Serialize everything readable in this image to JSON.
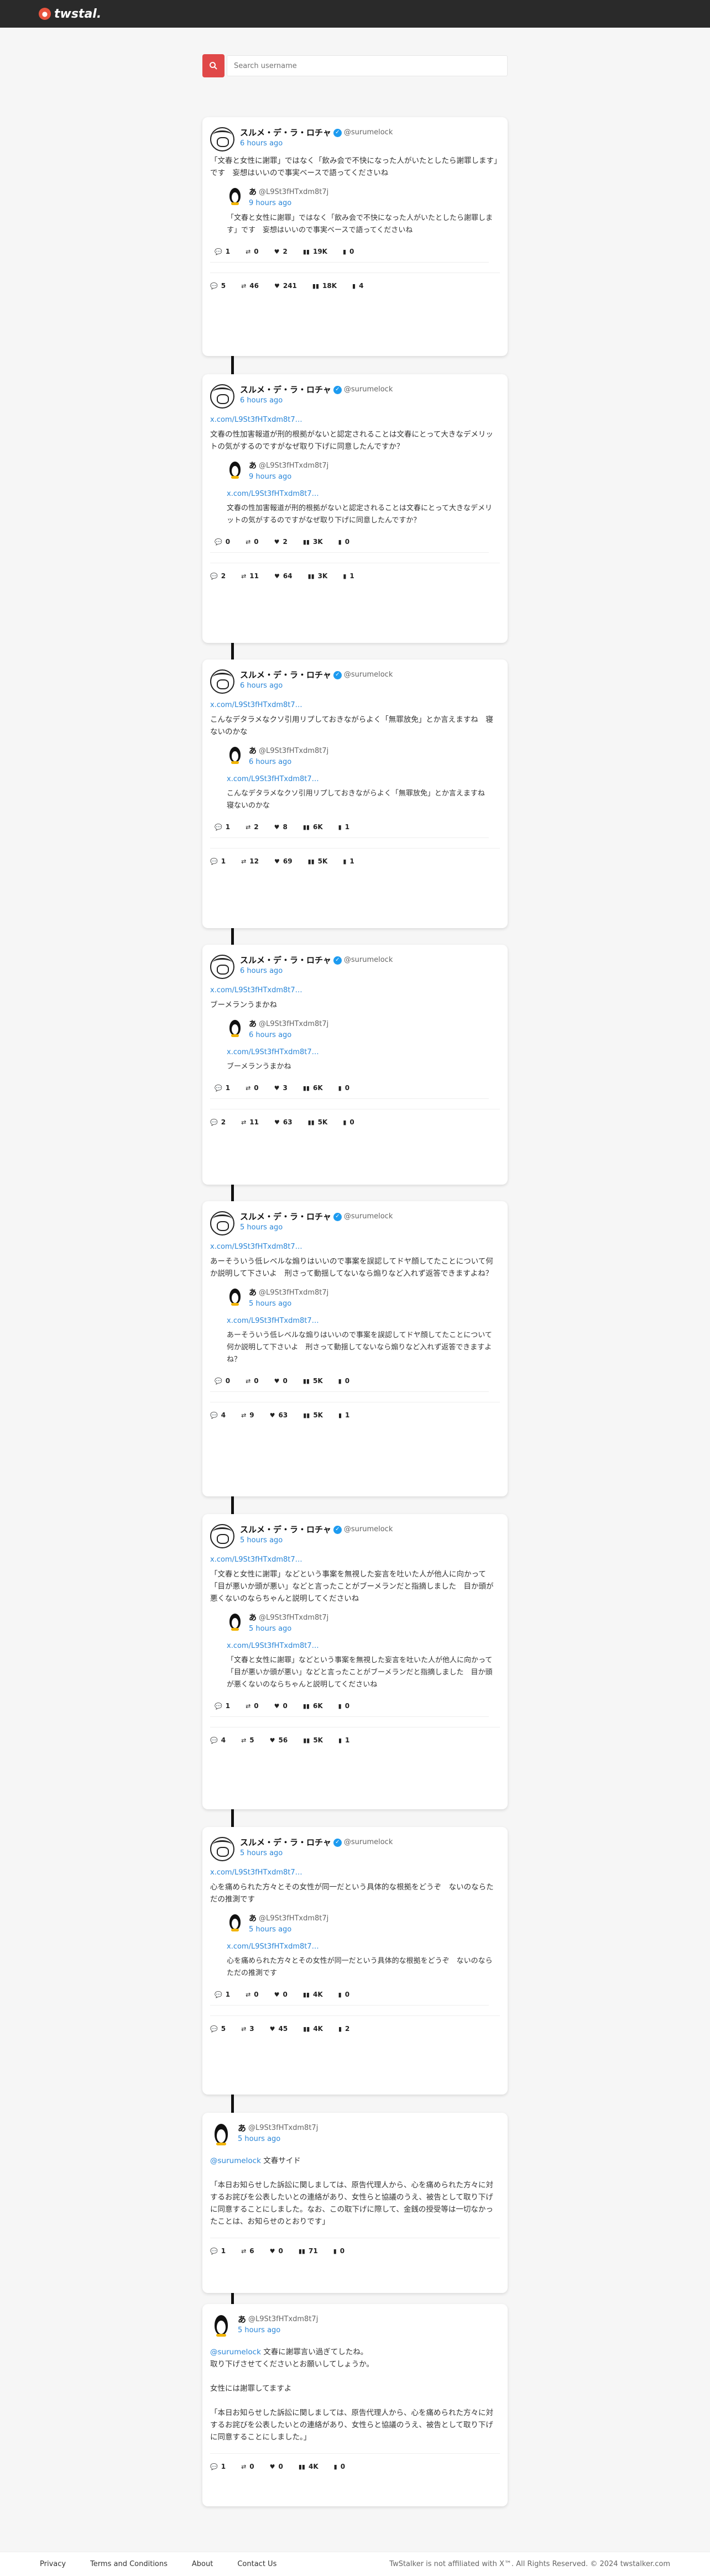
{
  "brand": {
    "name": "twstal."
  },
  "search": {
    "placeholder": "Search username"
  },
  "tweets": [
    {
      "name": "スルメ・デ・ラ・ロチャ",
      "handle": "@surumelock",
      "time": "6 hours ago",
      "link": "",
      "text": "「文春と女性に謝罪」ではなく「飲み会で不快になった人がいたとしたら謝罪します」です　妄想はいいので事実ベースで語ってくださいね",
      "quote": {
        "name": "あ",
        "handle": "@L9St3fHTxdm8t7j",
        "time": "9 hours ago",
        "link": "",
        "text": "「文春と女性に謝罪」ではなく「飲み会で不快になった人がいたとしたら謝罪します」です　妄想はいいので事実ベースで語ってくださいね",
        "stats": {
          "replies": "1",
          "retweets": "0",
          "likes": "2",
          "views": "19K",
          "bookmarks": "0"
        }
      },
      "stats": {
        "replies": "5",
        "retweets": "46",
        "likes": "241",
        "views": "18K",
        "bookmarks": "4"
      }
    },
    {
      "name": "スルメ・デ・ラ・ロチャ",
      "handle": "@surumelock",
      "time": "6 hours ago",
      "link": "x.com/L9St3fHTxdm8t7…",
      "text": "文春の性加害報道が刑的根拠がないと認定されることは文春にとって大きなデメリットの気がするのですがなぜ取り下げに同意したんですか？",
      "quote": {
        "name": "あ",
        "handle": "@L9St3fHTxdm8t7j",
        "time": "9 hours ago",
        "link": "x.com/L9St3fHTxdm8t7…",
        "text": "文春の性加害報道が刑的根拠がないと認定されることは文春にとって大きなデメリットの気がするのですがなぜ取り下げに同意したんですか？",
        "stats": {
          "replies": "0",
          "retweets": "0",
          "likes": "2",
          "views": "3K",
          "bookmarks": "0"
        }
      },
      "stats": {
        "replies": "2",
        "retweets": "11",
        "likes": "64",
        "views": "3K",
        "bookmarks": "1"
      }
    },
    {
      "name": "スルメ・デ・ラ・ロチャ",
      "handle": "@surumelock",
      "time": "6 hours ago",
      "link": "x.com/L9St3fHTxdm8t7…",
      "text": "こんなデタラメなクソ引用リプしておきながらよく「無罪放免」とか言えますね　寝ないのかな",
      "quote": {
        "name": "あ",
        "handle": "@L9St3fHTxdm8t7j",
        "time": "6 hours ago",
        "link": "x.com/L9St3fHTxdm8t7…",
        "text": "こんなデタラメなクソ引用リプしておきながらよく「無罪放免」とか言えますね　寝ないのかな",
        "stats": {
          "replies": "1",
          "retweets": "2",
          "likes": "8",
          "views": "6K",
          "bookmarks": "1"
        }
      },
      "stats": {
        "replies": "1",
        "retweets": "12",
        "likes": "69",
        "views": "5K",
        "bookmarks": "1"
      }
    },
    {
      "name": "スルメ・デ・ラ・ロチャ",
      "handle": "@surumelock",
      "time": "6 hours ago",
      "link": "x.com/L9St3fHTxdm8t7…",
      "text": "ブーメランうまかね",
      "quote": {
        "name": "あ",
        "handle": "@L9St3fHTxdm8t7j",
        "time": "6 hours ago",
        "link": "x.com/L9St3fHTxdm8t7…",
        "text": "ブーメランうまかね",
        "stats": {
          "replies": "1",
          "retweets": "0",
          "likes": "3",
          "views": "6K",
          "bookmarks": "0"
        }
      },
      "stats": {
        "replies": "2",
        "retweets": "11",
        "likes": "63",
        "views": "5K",
        "bookmarks": "0"
      }
    },
    {
      "name": "スルメ・デ・ラ・ロチャ",
      "handle": "@surumelock",
      "time": "5 hours ago",
      "link": "x.com/L9St3fHTxdm8t7…",
      "text": "あーそういう低レベルな煽りはいいので事案を誤認してドヤ顔してたことについて何か説明して下さいよ　刑さって動揺してないなら煽りなど入れず返答できますよね？",
      "quote": {
        "name": "あ",
        "handle": "@L9St3fHTxdm8t7j",
        "time": "5 hours ago",
        "link": "x.com/L9St3fHTxdm8t7…",
        "text": "あーそういう低レベルな煽りはいいので事案を誤認してドヤ顔してたことについて何か説明して下さいよ　刑さって動揺してないなら煽りなど入れず返答できますよね？",
        "stats": {
          "replies": "0",
          "retweets": "0",
          "likes": "0",
          "views": "5K",
          "bookmarks": "0"
        }
      },
      "stats": {
        "replies": "4",
        "retweets": "9",
        "likes": "63",
        "views": "5K",
        "bookmarks": "1"
      }
    },
    {
      "name": "スルメ・デ・ラ・ロチャ",
      "handle": "@surumelock",
      "time": "5 hours ago",
      "link": "x.com/L9St3fHTxdm8t7…",
      "text": "「文春と女性に謝罪」などという事案を無視した妄言を吐いた人が他人に向かって「目が悪いか頭が悪い」などと言ったことがブーメランだと指摘しました　目か頭が悪くないのならちゃんと説明してくださいね",
      "quote": {
        "name": "あ",
        "handle": "@L9St3fHTxdm8t7j",
        "time": "5 hours ago",
        "link": "x.com/L9St3fHTxdm8t7…",
        "text": "「文春と女性に謝罪」などという事案を無視した妄言を吐いた人が他人に向かって「目が悪いか頭が悪い」などと言ったことがブーメランだと指摘しました　目か頭が悪くないのならちゃんと説明してくださいね",
        "stats": {
          "replies": "1",
          "retweets": "0",
          "likes": "0",
          "views": "6K",
          "bookmarks": "0"
        }
      },
      "stats": {
        "replies": "4",
        "retweets": "5",
        "likes": "56",
        "views": "5K",
        "bookmarks": "1"
      }
    },
    {
      "name": "スルメ・デ・ラ・ロチャ",
      "handle": "@surumelock",
      "time": "5 hours ago",
      "link": "x.com/L9St3fHTxdm8t7…",
      "text": "心を痛められた方々とその女性が同一だという具体的な根拠をどうぞ　ないのならただの推測です",
      "quote": {
        "name": "あ",
        "handle": "@L9St3fHTxdm8t7j",
        "time": "5 hours ago",
        "link": "x.com/L9St3fHTxdm8t7…",
        "text": "心を痛められた方々とその女性が同一だという具体的な根拠をどうぞ　ないのならただの推測です",
        "stats": {
          "replies": "1",
          "retweets": "0",
          "likes": "0",
          "views": "4K",
          "bookmarks": "0"
        }
      },
      "stats": {
        "replies": "5",
        "retweets": "3",
        "likes": "45",
        "views": "4K",
        "bookmarks": "2"
      }
    }
  ],
  "plain_tweets": [
    {
      "name": "あ",
      "handle": "@L9St3fHTxdm8t7j",
      "time": "5 hours ago",
      "mention": "@surumelock",
      "mention_rest": " 文春サイド",
      "text": "「本日お知らせした訴訟に関しましては、原告代理人から、心を痛められた方々に対するお詫びを公表したいとの連絡があり、女性らと協議のうえ、被告として取り下げに同意することにしました。なお、この取下げに際して、金銭の授受等は一切なかったことは、お知らせのとおりです」",
      "stats": {
        "replies": "1",
        "retweets": "6",
        "likes": "0",
        "views": "71",
        "bookmarks": "0"
      }
    },
    {
      "name": "あ",
      "handle": "@L9St3fHTxdm8t7j",
      "time": "5 hours ago",
      "mention": "@surumelock",
      "mention_rest": " 文春に謝罪言い過ぎてしたね。\n取り下げさせてくださいとお願いしてしょうか。\n\n女性には謝罪してますよ\n\n「本日お知らせした訴訟に関しましては、原告代理人から、心を痛められた方々に対するお詫びを公表したいとの連絡があり、女性らと協議のうえ、被告として取り下げに同意することにしました。」",
      "text": "",
      "stats": {
        "replies": "1",
        "retweets": "0",
        "likes": "0",
        "views": "4K",
        "bookmarks": "0"
      }
    }
  ],
  "footer": {
    "privacy": "Privacy",
    "terms": "Terms and Conditions",
    "about": "About",
    "contact": "Contact Us",
    "copyright": "TwStalker is not affiliated with X™. All Rights Reserved. © 2024 twstalker.com"
  }
}
